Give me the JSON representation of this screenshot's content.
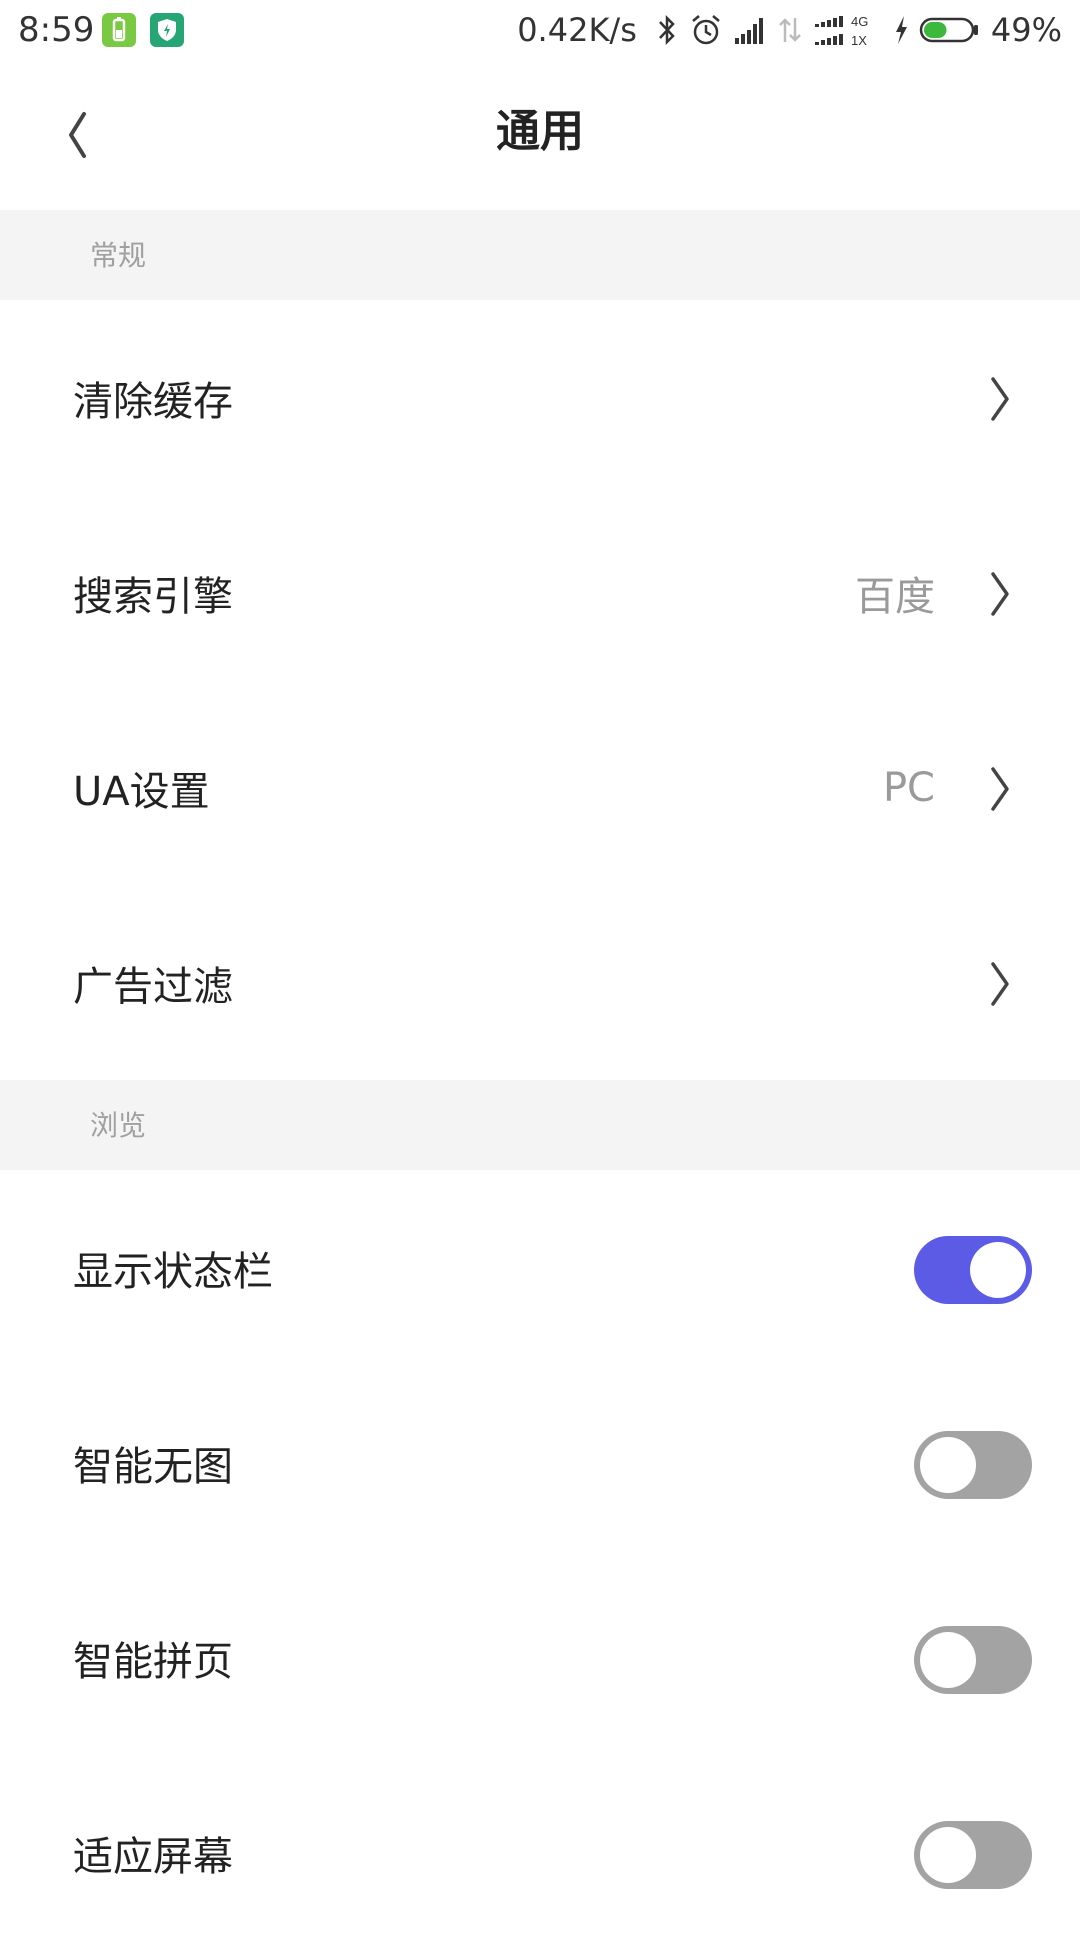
{
  "status_bar": {
    "time": "8:59",
    "net_speed": "0.42K/s",
    "network_type_top": "4G",
    "network_type_bottom": "1X",
    "battery_percent": "49%",
    "battery_level": 0.49,
    "icons": [
      "battery-app-icon",
      "shield-app-icon",
      "bluetooth-icon",
      "alarm-icon",
      "signal-icon",
      "data-arrows-icon",
      "signal-4g-icon",
      "charging-icon",
      "battery-icon"
    ]
  },
  "header": {
    "title": "通用",
    "back_icon": "chevron-left-icon"
  },
  "sections": {
    "general": {
      "title": "常规",
      "items": [
        {
          "label": "清除缓存",
          "value": ""
        },
        {
          "label": "搜索引擎",
          "value": "百度"
        },
        {
          "label": "UA设置",
          "value": "PC"
        },
        {
          "label": "广告过滤",
          "value": ""
        }
      ]
    },
    "browse": {
      "title": "浏览",
      "items": [
        {
          "label": "显示状态栏",
          "on": true
        },
        {
          "label": "智能无图",
          "on": false
        },
        {
          "label": "智能拼页",
          "on": false
        },
        {
          "label": "适应屏幕",
          "on": false
        }
      ]
    }
  },
  "colors": {
    "accent": "#5b5be6",
    "toggle_off": "#a3a3a3",
    "section_bg": "#f4f4f4"
  }
}
